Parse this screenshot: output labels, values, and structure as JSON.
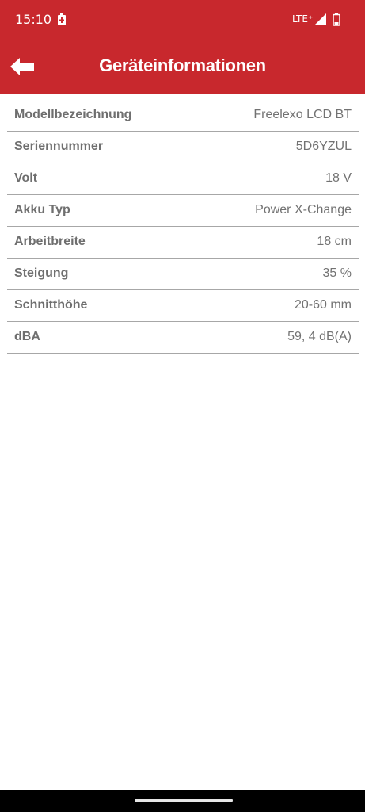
{
  "status_bar": {
    "time": "15:10",
    "network": "LTE⁺",
    "icons": [
      "battery-alert-icon",
      "signal-icon",
      "battery-low-icon"
    ]
  },
  "app_bar": {
    "title": "Geräteinformationen",
    "back_icon": "arrow-left-icon"
  },
  "colors": {
    "brand_red": "#c8282d",
    "label_gray": "#6f6f6f",
    "value_gray": "#727272",
    "divider": "#a7a7a7"
  },
  "info": [
    {
      "label": "Modellbezeichnung",
      "value": "Freelexo LCD BT"
    },
    {
      "label": "Seriennummer",
      "value": "5D6YZUL"
    },
    {
      "label": "Volt",
      "value": "18 V"
    },
    {
      "label": "Akku Typ",
      "value": "Power X-Change"
    },
    {
      "label": "Arbeitbreite",
      "value": "18 cm"
    },
    {
      "label": "Steigung",
      "value": "35 %"
    },
    {
      "label": "Schnitthöhe",
      "value": "20-60 mm"
    },
    {
      "label": "dBA",
      "value": "59, 4 dB(A)"
    }
  ]
}
